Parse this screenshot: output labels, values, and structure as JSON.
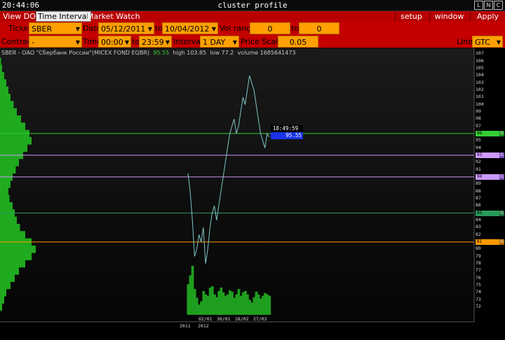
{
  "titlebar": {
    "clock": "20:44:06",
    "title": "cluster profile",
    "window_buttons": [
      "L",
      "N",
      "C"
    ]
  },
  "menubar": {
    "tabs": [
      "View DOM",
      "Time Interval",
      "Market Watch"
    ],
    "active_tab": "Time Interval",
    "right_buttons": [
      "setup",
      "window",
      "Apply"
    ]
  },
  "controls": {
    "ticker_label": "Ticker",
    "ticker_value": "SBER",
    "date_label": "Date",
    "date_from": "05/12/2011",
    "date_to_label": "to",
    "date_to": "10/04/2012",
    "vol_range_label": "Vol range",
    "vol_from": "0",
    "vol_to_label": "to",
    "vol_to": "0",
    "contract_label": "Contract",
    "contract_value": "-",
    "time_label": "Time",
    "time_from": "00:00",
    "time_to_label": "to",
    "time_to": "23:59",
    "interval_label": "Interval",
    "interval_value": "1 DAY",
    "price_scale_label": "Price Scale",
    "price_scale_value": "0.05",
    "line_label": "Line",
    "line_value": "GTC"
  },
  "info": {
    "symbol": "SBER - ОАО \"Сбербанк России\"(MICEX FOND EQBR)",
    "last": "95.55",
    "high": "high 103.85",
    "low": "low 77.2",
    "volume": "volume 1685641473"
  },
  "cursor": {
    "time": "18:49:59",
    "price": "95.55"
  },
  "price_levels": [
    {
      "price": 96,
      "color": "#33cc33",
      "tag": "96",
      "flag": "G",
      "flag_color": "#1a8a1a"
    },
    {
      "price": 93,
      "color": "#cc99ff",
      "tag": "93",
      "flag": "G",
      "flag_color": "#7a4ab8"
    },
    {
      "price": 90,
      "color": "#cc99ff",
      "tag": "90",
      "flag": "G",
      "flag_color": "#7a4ab8"
    },
    {
      "price": 85,
      "color": "#2a9a5a",
      "tag": "85",
      "flag": "G",
      "flag_color": "#1a6a3a"
    },
    {
      "price": 81,
      "color": "#ff9900",
      "tag": "81",
      "flag": "G",
      "flag_color": "#b86a00"
    }
  ],
  "y_ticks": [
    "107",
    "106",
    "105",
    "104",
    "103",
    "102",
    "101",
    "100",
    "99",
    "98",
    "97",
    "96",
    "95",
    "94",
    "93",
    "92",
    "91",
    "90",
    "89",
    "88",
    "87",
    "86",
    "85",
    "84",
    "83",
    "82",
    "81",
    "80",
    "79",
    "78",
    "77",
    "76",
    "75",
    "74",
    "73",
    "72"
  ],
  "x_ticks": [
    "02/01",
    "30/01",
    "28/02",
    "27/03"
  ],
  "x_years": [
    "2011",
    "2012"
  ],
  "colors": {
    "price_line": "#7fc6c6",
    "volume": "#1f9e1f",
    "profile": "#1faa1f",
    "hline_cursor": "#33cc33"
  },
  "chart_data": {
    "type": "line",
    "y_range": [
      71.5,
      107.5
    ],
    "series": [
      {
        "values": [
          90.5,
          88,
          84,
          79,
          80,
          82,
          81,
          83,
          78,
          80,
          83,
          85,
          86,
          84,
          86,
          88,
          90,
          92,
          94,
          96,
          97,
          98,
          96,
          97,
          99,
          101,
          100,
          102,
          104,
          103,
          102,
          100,
          98,
          96,
          95,
          94,
          96,
          95.5
        ]
      }
    ],
    "volume": [
      45,
      58,
      72,
      38,
      25,
      15,
      20,
      35,
      30,
      28,
      40,
      42,
      30,
      26,
      35,
      40,
      33,
      28,
      30,
      36,
      34,
      25,
      30,
      38,
      28,
      33,
      35,
      30,
      22,
      18,
      26,
      34,
      30,
      24,
      28,
      32,
      30,
      28
    ],
    "profile": [
      0,
      1,
      2,
      4,
      6,
      8,
      10,
      13,
      16,
      20,
      24,
      28,
      30,
      26,
      22,
      18,
      15,
      12,
      10,
      8,
      9,
      12,
      14,
      16,
      19,
      24,
      30,
      34,
      30,
      24,
      18,
      14,
      10,
      6,
      4,
      2
    ]
  }
}
